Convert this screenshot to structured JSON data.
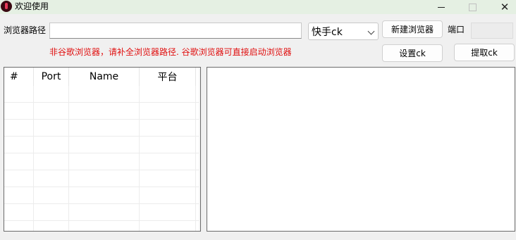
{
  "window": {
    "title": "欢迎使用",
    "minimize_icon": "minimize-icon",
    "maximize_icon": "maximize-icon",
    "close_glyph": "✕"
  },
  "form": {
    "browser_path_label": "浏览器路径",
    "browser_path_value": "",
    "platform_select_value": "快手ck",
    "new_browser_label": "新建浏览器",
    "port_label": "端口",
    "port_value": "",
    "warning_text": "非谷歌浏览器，请补全浏览器路径. 谷歌浏览器可直接启动浏览器",
    "warning_color": "#e01010",
    "set_ck_label": "设置ck",
    "extract_ck_label": "提取ck"
  },
  "table": {
    "columns": [
      "#",
      "Port",
      "Name",
      "平台"
    ],
    "rows": []
  }
}
